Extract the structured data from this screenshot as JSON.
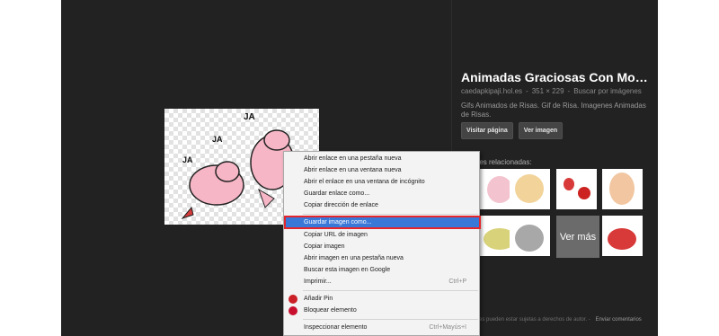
{
  "result": {
    "title": "Animadas Graciosas Con Movimient...",
    "source": "caedapkipaji.hol.es",
    "dimensions": "351 × 229",
    "search_by_image": "Buscar por imágenes",
    "description": "Gifs Animados de Risas. Gif de Risa. Imagenes Animadas de Risas.",
    "visit_label": "Visitar página",
    "view_label": "Ver imagen"
  },
  "related": {
    "label": "genes relacionadas:",
    "more_label": "Ver más"
  },
  "footer": {
    "notice": "genes pueden estar sujetas a derechos de autor.",
    "separator": "-",
    "feedback_label": "Enviar comentarios"
  },
  "context_menu": {
    "items": [
      {
        "label": "Abrir enlace en una pestaña nueva"
      },
      {
        "label": "Abrir enlace en una ventana nueva"
      },
      {
        "label": "Abrir el enlace en una ventana de incógnito"
      },
      {
        "label": "Guardar enlace como..."
      },
      {
        "label": "Copiar dirección de enlace"
      },
      {
        "label": "Guardar imagen como..."
      },
      {
        "label": "Copiar URL de imagen"
      },
      {
        "label": "Copiar imagen"
      },
      {
        "label": "Abrir imagen en una pestaña nueva"
      },
      {
        "label": "Buscar esta imagen en Google"
      },
      {
        "label": "Imprimir...",
        "shortcut": "Ctrl+P"
      },
      {
        "label": "Añadir Pin"
      },
      {
        "label": "Bloquear elemento"
      },
      {
        "label": "Inspeccionar elemento",
        "shortcut": "Ctrl+Mayús+I"
      }
    ]
  },
  "artwork": {
    "laugh_text": "JA"
  },
  "colors": {
    "highlight": "#3a78d8",
    "annotation_border": "#e3262c",
    "background": "#222222"
  },
  "icons": {
    "pin": "pinterest-icon",
    "block": "block-icon"
  }
}
